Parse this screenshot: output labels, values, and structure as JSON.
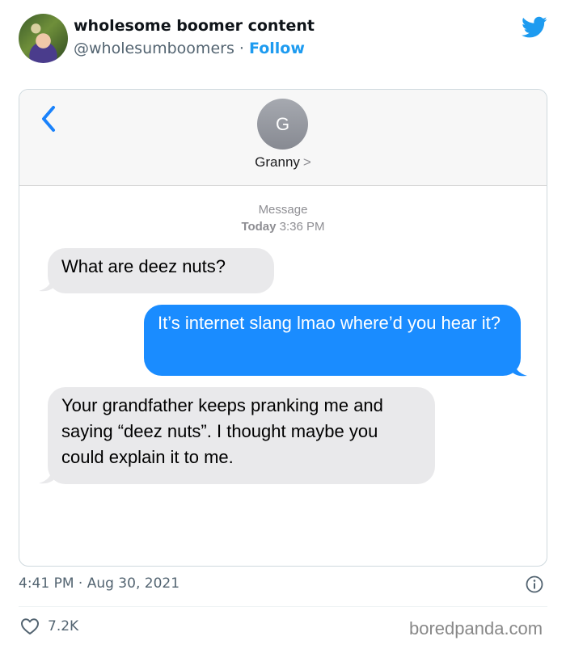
{
  "tweet": {
    "author_name": "wholesome boomer content",
    "handle": "@wholesumboomers",
    "separator": "·",
    "follow_label": "Follow",
    "timestamp": "4:41 PM · Aug 30, 2021",
    "like_count": "7.2K",
    "accent_color": "#1d9bf0"
  },
  "messages_app": {
    "contact_initial": "G",
    "contact_name": "Granny",
    "contact_chevron": ">",
    "thread_label": "Message",
    "thread_day": "Today",
    "thread_time": "3:36 PM",
    "bubbles": [
      {
        "direction": "incoming",
        "text": "What are deez nuts?"
      },
      {
        "direction": "outgoing",
        "text": "It’s internet slang lmao where’d you hear it?"
      },
      {
        "direction": "incoming",
        "text": "Your grandfather keeps pranking me and saying “deez nuts”. I thought maybe you could explain it to me."
      }
    ],
    "incoming_color": "#e9e9eb",
    "outgoing_color": "#1a8cff"
  },
  "watermark": "boredpanda.com",
  "icons": {
    "brand": "twitter-bird-icon",
    "back": "chevron-left-icon",
    "info": "info-icon",
    "like": "heart-icon"
  }
}
